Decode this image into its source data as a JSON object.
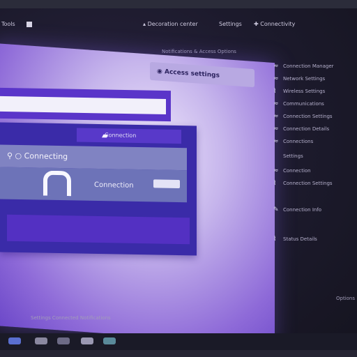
{
  "toolbar": {
    "left_label": "Tools",
    "items": [
      "Decoration center",
      "Settings",
      "Connectivity"
    ]
  },
  "main": {
    "header_line": "Notifications & Access Options",
    "tag": "Access settings",
    "dialog": {
      "tab": "Connection",
      "head": "Connecting",
      "body_label": "Connection",
      "icon": "folder-icon"
    }
  },
  "sidebar": {
    "items": [
      {
        "icon": "wifi-icon",
        "label": "Connection Manager"
      },
      {
        "icon": "wifi-icon",
        "label": "Network Settings"
      },
      {
        "icon": "signal-icon",
        "label": "Wireless Settings"
      },
      {
        "icon": "wifi-icon",
        "label": "Communications"
      },
      {
        "icon": "wifi-icon",
        "label": "Connection Settings"
      },
      {
        "icon": "wifi-icon",
        "label": "Connection Details"
      },
      {
        "icon": "wifi-icon",
        "label": "Connections"
      },
      {
        "icon": "wifi-icon",
        "label": "Settings"
      },
      {
        "icon": "wifi-icon",
        "label": "Connection"
      },
      {
        "icon": "signal-icon",
        "label": "Connection Settings"
      },
      {
        "icon": "edit-icon",
        "label": "Connection Info"
      },
      {
        "icon": "signal-icon",
        "label": "Status Details"
      }
    ]
  },
  "status_text": "Settings Connected Notifications",
  "corner_text": "Options",
  "colors": {
    "accent": "#5a35c9",
    "panel": "#c6b5ec",
    "background": "#1c1a2c"
  }
}
